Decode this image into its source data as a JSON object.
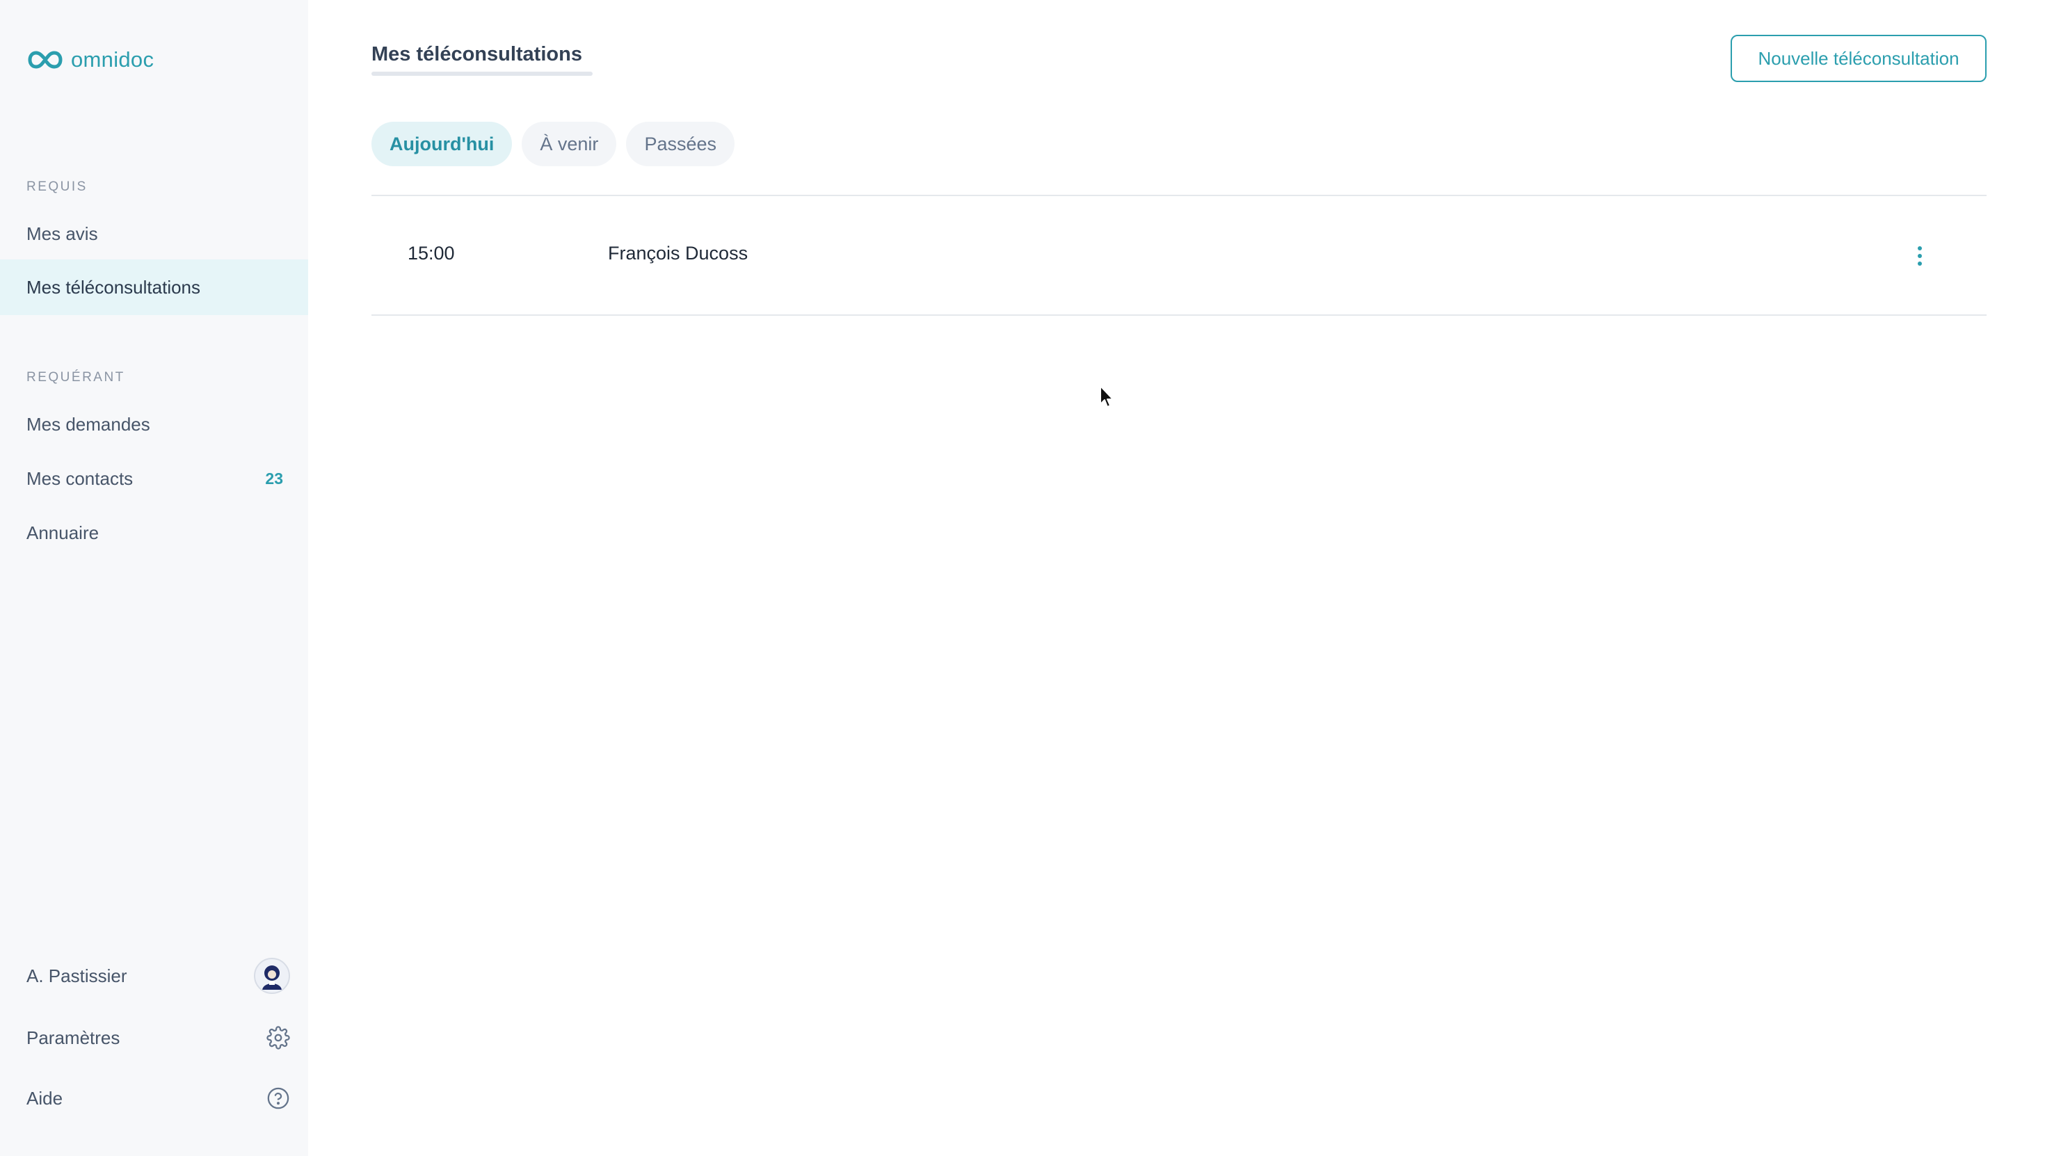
{
  "brand": {
    "name": "omnidoc",
    "color": "#2b9eae",
    "logo_icon": "infinity-icon"
  },
  "sidebar": {
    "sections": [
      {
        "label": "REQUIS",
        "items": [
          {
            "label": "Mes avis",
            "active": false
          },
          {
            "label": "Mes téléconsultations",
            "active": true
          }
        ]
      },
      {
        "label": "REQUÉRANT",
        "items": [
          {
            "label": "Mes demandes",
            "active": false
          },
          {
            "label": "Mes contacts",
            "badge": "23",
            "active": false
          },
          {
            "label": "Annuaire",
            "active": false
          }
        ]
      }
    ],
    "footer": {
      "user": {
        "label": "A. Pastissier",
        "icon": "avatar"
      },
      "settings": {
        "label": "Paramètres",
        "icon": "gear-icon"
      },
      "help": {
        "label": "Aide",
        "icon": "help-circle-icon"
      }
    }
  },
  "main": {
    "title": "Mes téléconsultations",
    "new_button": "Nouvelle téléconsultation",
    "tabs": [
      {
        "label": "Aujourd'hui",
        "active": true
      },
      {
        "label": "À venir",
        "active": false
      },
      {
        "label": "Passées",
        "active": false
      }
    ],
    "rows": [
      {
        "time": "15:00",
        "name": "François Ducoss",
        "menu_icon": "more-vertical-icon"
      }
    ]
  },
  "colors": {
    "accent": "#2b9eae",
    "active_bg": "#e6f5f8",
    "sidebar_bg": "#f7f8fa"
  }
}
